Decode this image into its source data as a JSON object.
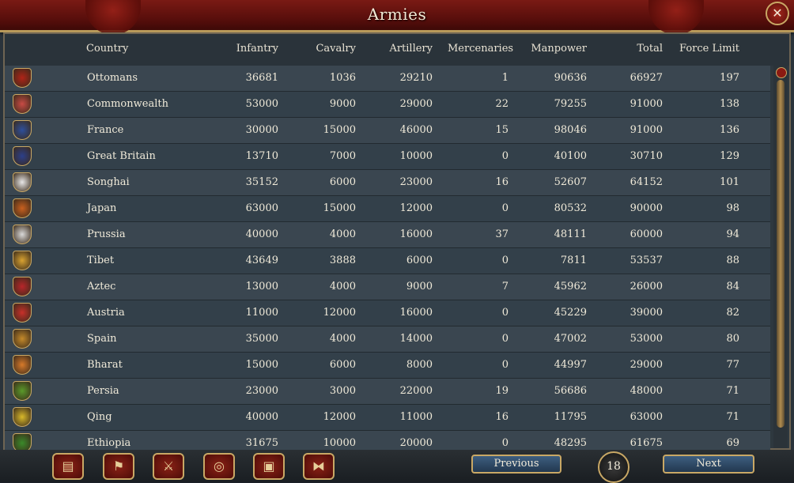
{
  "window": {
    "title": "Armies"
  },
  "columns": {
    "country": "Country",
    "infantry": "Infantry",
    "cavalry": "Cavalry",
    "artillery": "Artillery",
    "mercenaries": "Mercenaries",
    "manpower": "Manpower",
    "total": "Total",
    "force_limit": "Force Limit"
  },
  "rows": [
    {
      "country": "Ottomans",
      "infantry": "36681",
      "cavalry": "1036",
      "artillery": "29210",
      "mercenaries": "1",
      "manpower": "90636",
      "total": "66927",
      "force_limit": "197",
      "flag": "#b02418"
    },
    {
      "country": "Commonwealth",
      "infantry": "53000",
      "cavalry": "9000",
      "artillery": "29000",
      "mercenaries": "22",
      "manpower": "79255",
      "total": "91000",
      "force_limit": "138",
      "flag": "#c94b45"
    },
    {
      "country": "France",
      "infantry": "30000",
      "cavalry": "15000",
      "artillery": "46000",
      "mercenaries": "15",
      "manpower": "98046",
      "total": "91000",
      "force_limit": "136",
      "flag": "#2e4f9c"
    },
    {
      "country": "Great Britain",
      "infantry": "13710",
      "cavalry": "7000",
      "artillery": "10000",
      "mercenaries": "0",
      "manpower": "40100",
      "total": "30710",
      "force_limit": "129",
      "flag": "#2c3f8a"
    },
    {
      "country": "Songhai",
      "infantry": "35152",
      "cavalry": "6000",
      "artillery": "23000",
      "mercenaries": "16",
      "manpower": "52607",
      "total": "64152",
      "force_limit": "101",
      "flag": "#e8e8e8"
    },
    {
      "country": "Japan",
      "infantry": "63000",
      "cavalry": "15000",
      "artillery": "12000",
      "mercenaries": "0",
      "manpower": "80532",
      "total": "90000",
      "force_limit": "98",
      "flag": "#c9601f"
    },
    {
      "country": "Prussia",
      "infantry": "40000",
      "cavalry": "4000",
      "artillery": "16000",
      "mercenaries": "37",
      "manpower": "48111",
      "total": "60000",
      "force_limit": "94",
      "flag": "#d9d9d9"
    },
    {
      "country": "Tibet",
      "infantry": "43649",
      "cavalry": "3888",
      "artillery": "6000",
      "mercenaries": "0",
      "manpower": "7811",
      "total": "53537",
      "force_limit": "88",
      "flag": "#d9a331"
    },
    {
      "country": "Aztec",
      "infantry": "13000",
      "cavalry": "4000",
      "artillery": "9000",
      "mercenaries": "7",
      "manpower": "45962",
      "total": "26000",
      "force_limit": "84",
      "flag": "#b8262a"
    },
    {
      "country": "Austria",
      "infantry": "11000",
      "cavalry": "12000",
      "artillery": "16000",
      "mercenaries": "0",
      "manpower": "45229",
      "total": "39000",
      "force_limit": "82",
      "flag": "#c8302a"
    },
    {
      "country": "Spain",
      "infantry": "35000",
      "cavalry": "4000",
      "artillery": "14000",
      "mercenaries": "0",
      "manpower": "47002",
      "total": "53000",
      "force_limit": "80",
      "flag": "#c58a2a"
    },
    {
      "country": "Bharat",
      "infantry": "15000",
      "cavalry": "6000",
      "artillery": "8000",
      "mercenaries": "0",
      "manpower": "44997",
      "total": "29000",
      "force_limit": "77",
      "flag": "#d77a2a"
    },
    {
      "country": "Persia",
      "infantry": "23000",
      "cavalry": "3000",
      "artillery": "22000",
      "mercenaries": "19",
      "manpower": "56686",
      "total": "48000",
      "force_limit": "71",
      "flag": "#5a9a2a"
    },
    {
      "country": "Qing",
      "infantry": "40000",
      "cavalry": "12000",
      "artillery": "11000",
      "mercenaries": "16",
      "manpower": "11795",
      "total": "63000",
      "force_limit": "71",
      "flag": "#d8b92a"
    },
    {
      "country": "Ethiopia",
      "infantry": "31675",
      "cavalry": "10000",
      "artillery": "20000",
      "mercenaries": "0",
      "manpower": "48295",
      "total": "61675",
      "force_limit": "69",
      "flag": "#3a8a2a"
    }
  ],
  "toolbar": [
    {
      "name": "ledger-icon",
      "glyph": "▤"
    },
    {
      "name": "flag-icon",
      "glyph": "⚑"
    },
    {
      "name": "crossed-swords-icon",
      "glyph": "⚔"
    },
    {
      "name": "coins-icon",
      "glyph": "◎"
    },
    {
      "name": "crate-icon",
      "glyph": "▣"
    },
    {
      "name": "handshake-icon",
      "glyph": "⧓"
    }
  ],
  "pagination": {
    "previous_label": "Previous",
    "next_label": "Next",
    "page": "18"
  }
}
